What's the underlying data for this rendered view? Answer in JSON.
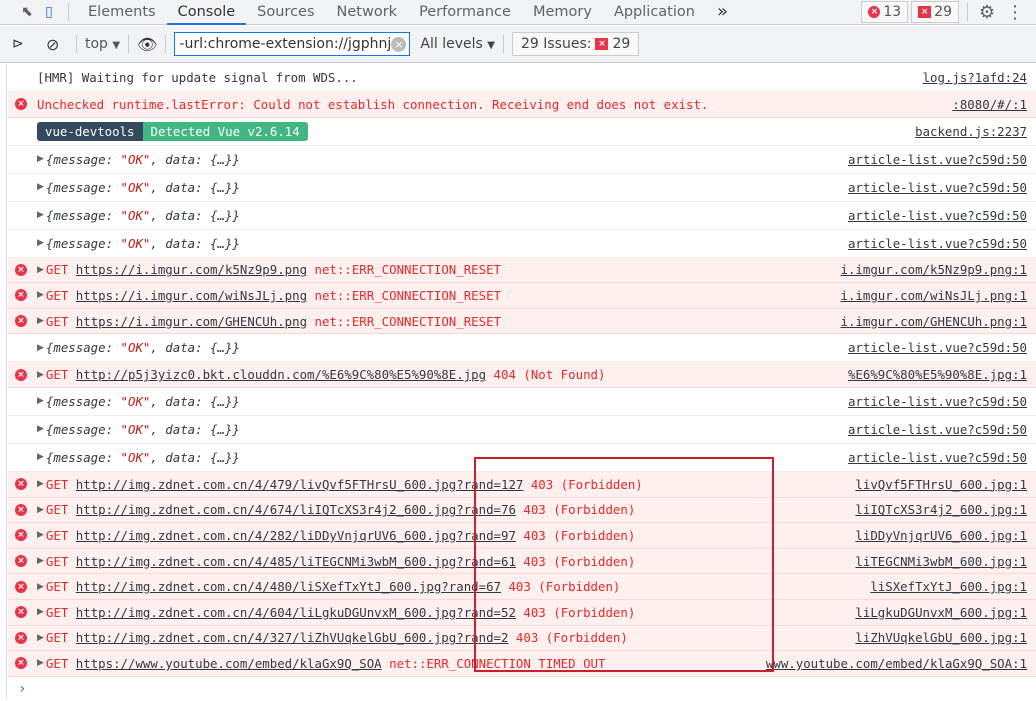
{
  "tabbar": {
    "tabs": [
      "Elements",
      "Console",
      "Sources",
      "Network",
      "Performance",
      "Memory",
      "Application"
    ],
    "active": "Console",
    "more": "»",
    "error_count": "13",
    "issue_count": "29"
  },
  "toolbar": {
    "context": "top",
    "filter_value": "-url:chrome-extension://jgphnjc",
    "levels": "All levels",
    "issues_label": "29 Issues:",
    "issues_count": "29"
  },
  "colors": {
    "accent": "#1a73e8",
    "error": "#e52a2a",
    "error_bg": "#fff0f0",
    "vue_dark": "#35495e",
    "vue_green": "#41b883"
  },
  "rows": [
    {
      "type": "log",
      "text": "[HMR] Waiting for update signal from WDS...",
      "src": "log.js?1afd:24"
    },
    {
      "type": "error",
      "text": "Unchecked runtime.lastError: Could not establish connection. Receiving end does not exist.",
      "src": ":8080/#/:1"
    },
    {
      "type": "vue",
      "a": "vue-devtools",
      "b": "Detected Vue v2.6.14",
      "src": "backend.js:2237"
    },
    {
      "type": "obj",
      "src": "article-list.vue?c59d:50"
    },
    {
      "type": "obj",
      "src": "article-list.vue?c59d:50"
    },
    {
      "type": "obj",
      "src": "article-list.vue?c59d:50"
    },
    {
      "type": "obj",
      "src": "article-list.vue?c59d:50"
    },
    {
      "type": "get",
      "url": "https://i.imgur.com/k5Nz9p9.png",
      "status": "net::ERR_CONNECTION_RESET",
      "src": "i.imgur.com/k5Nz9p9.png:1"
    },
    {
      "type": "get",
      "url": "https://i.imgur.com/wiNsJLj.png",
      "status": "net::ERR_CONNECTION_RESET",
      "src": "i.imgur.com/wiNsJLj.png:1"
    },
    {
      "type": "get",
      "url": "https://i.imgur.com/GHENCUh.png",
      "status": "net::ERR_CONNECTION_RESET",
      "src": "i.imgur.com/GHENCUh.png:1"
    },
    {
      "type": "obj",
      "src": "article-list.vue?c59d:50"
    },
    {
      "type": "get",
      "url": "http://p5j3yizc0.bkt.clouddn.com/%E6%9C%80%E5%90%8E.jpg",
      "status": "404 (Not Found)",
      "src": "%E6%9C%80%E5%90%8E.jpg:1"
    },
    {
      "type": "obj",
      "src": "article-list.vue?c59d:50"
    },
    {
      "type": "obj",
      "src": "article-list.vue?c59d:50"
    },
    {
      "type": "obj",
      "src": "article-list.vue?c59d:50"
    },
    {
      "type": "get",
      "url": "http://img.zdnet.com.cn/4/479/livQvf5FTHrsU_600.jpg?rand=127",
      "status": "403 (Forbidden)",
      "src": "livQvf5FTHrsU_600.jpg:1"
    },
    {
      "type": "get",
      "url": "http://img.zdnet.com.cn/4/674/liIQTcXS3r4j2_600.jpg?rand=76",
      "status": "403 (Forbidden)",
      "src": "liIQTcXS3r4j2_600.jpg:1"
    },
    {
      "type": "get",
      "url": "http://img.zdnet.com.cn/4/282/liDDyVnjqrUV6_600.jpg?rand=97",
      "status": "403 (Forbidden)",
      "src": "liDDyVnjqrUV6_600.jpg:1"
    },
    {
      "type": "get",
      "url": "http://img.zdnet.com.cn/4/485/liTEGCNMi3wbM_600.jpg?rand=61",
      "status": "403 (Forbidden)",
      "src": "liTEGCNMi3wbM_600.jpg:1"
    },
    {
      "type": "get",
      "url": "http://img.zdnet.com.cn/4/480/liSXefTxYtJ_600.jpg?rand=67",
      "status": "403 (Forbidden)",
      "src": "liSXefTxYtJ_600.jpg:1"
    },
    {
      "type": "get",
      "url": "http://img.zdnet.com.cn/4/604/liLgkuDGUnvxM_600.jpg?rand=52",
      "status": "403 (Forbidden)",
      "src": "liLgkuDGUnvxM_600.jpg:1"
    },
    {
      "type": "get",
      "url": "http://img.zdnet.com.cn/4/327/liZhVUqkelGbU_600.jpg?rand=2",
      "status": "403 (Forbidden)",
      "src": "liZhVUqkelGbU_600.jpg:1"
    },
    {
      "type": "get",
      "url": "https://www.youtube.com/embed/klaGx9Q_SOA",
      "status": "net::ERR_CONNECTION_TIMED_OUT",
      "src": "www.youtube.com/embed/klaGx9Q_SOA:1"
    }
  ],
  "obj": {
    "open": "{message: ",
    "msg": "\"OK\"",
    "rest": ", data: {…}}"
  },
  "get_method": "GET",
  "prompt": "›"
}
